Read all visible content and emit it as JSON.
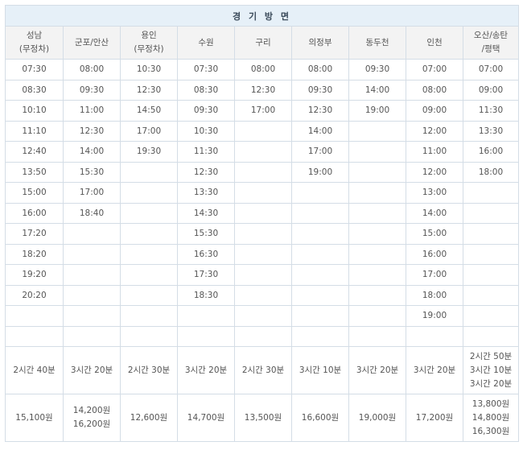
{
  "title": "경 기 방 면",
  "columns": [
    {
      "lines": [
        "성남",
        "(무정차)"
      ]
    },
    {
      "lines": [
        "군포/안산"
      ]
    },
    {
      "lines": [
        "용인",
        "(무정차)"
      ]
    },
    {
      "lines": [
        "수원"
      ]
    },
    {
      "lines": [
        "구리"
      ]
    },
    {
      "lines": [
        "의정부"
      ]
    },
    {
      "lines": [
        "동두천"
      ]
    },
    {
      "lines": [
        "인천"
      ]
    },
    {
      "lines": [
        "오산/송탄",
        "/평택"
      ]
    }
  ],
  "times": [
    [
      "07:30",
      "08:00",
      "10:30",
      "07:30",
      "08:00",
      "08:00",
      "09:30",
      "07:00",
      "07:00"
    ],
    [
      "08:30",
      "09:30",
      "12:30",
      "08:30",
      "12:30",
      "09:30",
      "14:00",
      "08:00",
      "09:00"
    ],
    [
      "10:10",
      "11:00",
      "14:50",
      "09:30",
      "17:00",
      "12:30",
      "19:00",
      "09:00",
      "11:30"
    ],
    [
      "11:10",
      "12:30",
      "17:00",
      "10:30",
      "",
      "14:00",
      "",
      "12:00",
      "13:30"
    ],
    [
      "12:40",
      "14:00",
      "19:30",
      "11:30",
      "",
      "17:00",
      "",
      "11:00",
      "16:00"
    ],
    [
      "13:50",
      "15:30",
      "",
      "12:30",
      "",
      "19:00",
      "",
      "12:00",
      "18:00"
    ],
    [
      "15:00",
      "17:00",
      "",
      "13:30",
      "",
      "",
      "",
      "13:00",
      ""
    ],
    [
      "16:00",
      "18:40",
      "",
      "14:30",
      "",
      "",
      "",
      "14:00",
      ""
    ],
    [
      "17:20",
      "",
      "",
      "15:30",
      "",
      "",
      "",
      "15:00",
      ""
    ],
    [
      "18:20",
      "",
      "",
      "16:30",
      "",
      "",
      "",
      "16:00",
      ""
    ],
    [
      "19:20",
      "",
      "",
      "17:30",
      "",
      "",
      "",
      "17:00",
      ""
    ],
    [
      "20:20",
      "",
      "",
      "18:30",
      "",
      "",
      "",
      "18:00",
      ""
    ],
    [
      "",
      "",
      "",
      "",
      "",
      "",
      "",
      "19:00",
      ""
    ],
    [
      "",
      "",
      "",
      "",
      "",
      "",
      "",
      "",
      ""
    ]
  ],
  "durations": [
    [
      "2시간 40분"
    ],
    [
      "3시간 20분"
    ],
    [
      "2시간 30분"
    ],
    [
      "3시간 20분"
    ],
    [
      "2시간 30분"
    ],
    [
      "3시간 10분"
    ],
    [
      "3시간 20분"
    ],
    [
      "3시간 20분"
    ],
    [
      "2시간 50분",
      "3시간 10분",
      "3시간 20분"
    ]
  ],
  "fares": [
    [
      "15,100원"
    ],
    [
      "14,200원",
      "16,200원"
    ],
    [
      "12,600원"
    ],
    [
      "14,700원"
    ],
    [
      "13,500원"
    ],
    [
      "16,600원"
    ],
    [
      "19,000원"
    ],
    [
      "17,200원"
    ],
    [
      "13,800원",
      "14,800원",
      "16,300원"
    ]
  ]
}
